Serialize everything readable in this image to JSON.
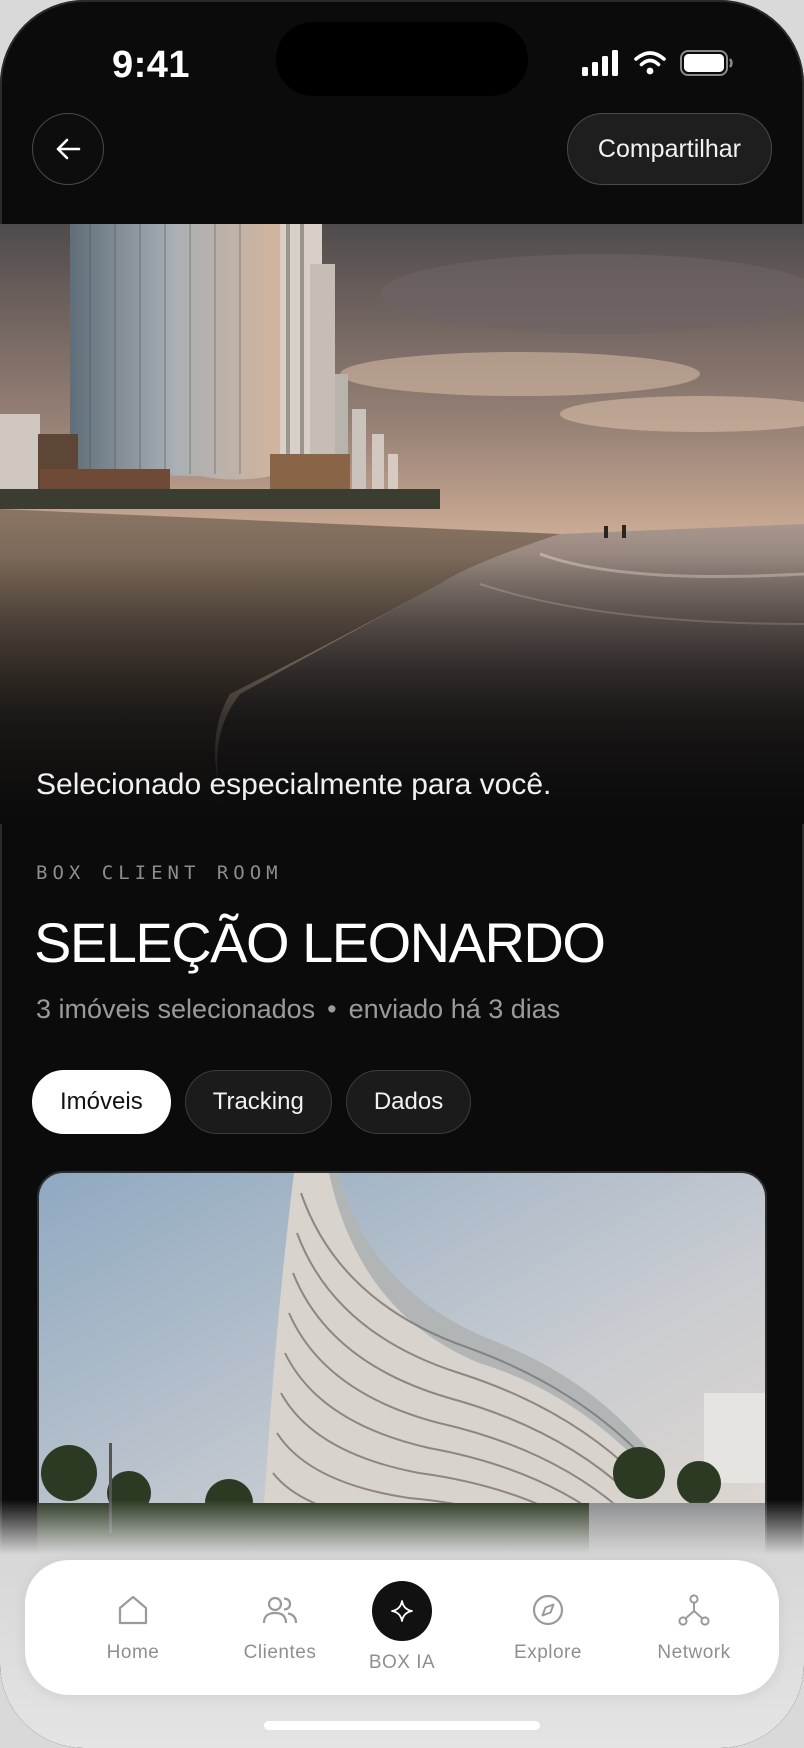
{
  "status_bar": {
    "time": "9:41"
  },
  "header": {
    "share_label": "Compartilhar"
  },
  "hero": {
    "tagline": "Selecionado especialmente para você."
  },
  "room": {
    "eyebrow": "BOX CLIENT ROOM",
    "title": "SELEÇÃO LEONARDO",
    "count_text": "3 imóveis selecionados",
    "separator": "•",
    "sent_text": "enviado há 3 dias"
  },
  "tabs": [
    {
      "label": "Imóveis",
      "active": true
    },
    {
      "label": "Tracking",
      "active": false
    },
    {
      "label": "Dados",
      "active": false
    }
  ],
  "bottom_nav": {
    "items": [
      {
        "label": "Home",
        "icon": "home-icon"
      },
      {
        "label": "Clientes",
        "icon": "users-icon"
      },
      {
        "label": "BOX IA",
        "icon": "sparkle-icon"
      },
      {
        "label": "Explore",
        "icon": "compass-icon"
      },
      {
        "label": "Network",
        "icon": "network-icon"
      }
    ]
  },
  "colors": {
    "background": "#0b0b0b",
    "nav_background": "#ffffff",
    "active_tab": "#ffffff"
  }
}
